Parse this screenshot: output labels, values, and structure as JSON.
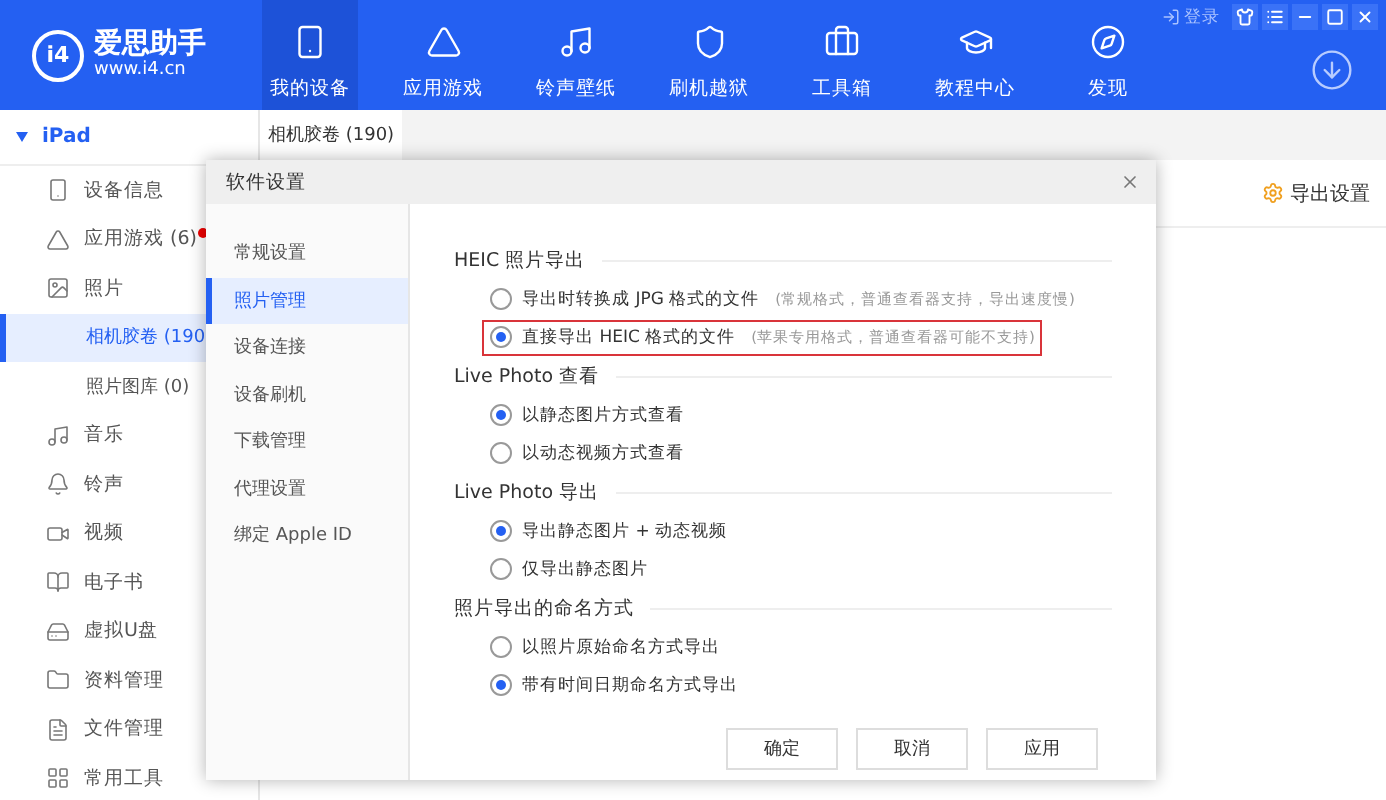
{
  "header": {
    "logo_mark": "i4",
    "logo_name": "爱思助手",
    "logo_url": "www.i4.cn",
    "login": "登录",
    "nav": [
      {
        "label": "我的设备",
        "selected": true
      },
      {
        "label": "应用游戏",
        "selected": false
      },
      {
        "label": "铃声壁纸",
        "selected": false
      },
      {
        "label": "刷机越狱",
        "selected": false
      },
      {
        "label": "工具箱",
        "selected": false
      },
      {
        "label": "教程中心",
        "selected": false
      },
      {
        "label": "发现",
        "selected": false
      }
    ]
  },
  "sidebar": {
    "device": "iPad",
    "expanded": true,
    "items": [
      {
        "label": "设备信息",
        "selected": false
      },
      {
        "label": "应用游戏 (6)",
        "selected": false,
        "badge": true
      },
      {
        "label": "照片",
        "selected": false,
        "children": [
          {
            "label": "相机胶卷 (190",
            "selected": true
          },
          {
            "label": "照片图库 (0)",
            "selected": false
          }
        ]
      },
      {
        "label": "音乐",
        "selected": false
      },
      {
        "label": "铃声",
        "selected": false
      },
      {
        "label": "视频",
        "selected": false
      },
      {
        "label": "电子书",
        "selected": false
      },
      {
        "label": "虚拟U盘",
        "selected": false
      },
      {
        "label": "资料管理",
        "selected": false
      },
      {
        "label": "文件管理",
        "selected": false
      },
      {
        "label": "常用工具",
        "selected": false
      }
    ]
  },
  "tabs": [
    {
      "label": "相机胶卷 (190)",
      "selected": true
    }
  ],
  "toolbar": {
    "export_settings": "导出设置"
  },
  "dialog": {
    "title": "软件设置",
    "nav": [
      {
        "label": "常规设置",
        "selected": false
      },
      {
        "label": "照片管理",
        "selected": true
      },
      {
        "label": "设备连接",
        "selected": false
      },
      {
        "label": "设备刷机",
        "selected": false
      },
      {
        "label": "下载管理",
        "selected": false
      },
      {
        "label": "代理设置",
        "selected": false
      },
      {
        "label": "绑定 Apple ID",
        "selected": false
      }
    ],
    "sections": [
      {
        "title": "HEIC 照片导出",
        "options": [
          {
            "label": "导出时转换成 JPG 格式的文件",
            "note": "(常规格式，普通查看器支持，导出速度慢)",
            "selected": false,
            "highlighted": false
          },
          {
            "label": "直接导出 HEIC 格式的文件",
            "note": "(苹果专用格式，普通查看器可能不支持)",
            "selected": true,
            "highlighted": true
          }
        ]
      },
      {
        "title": "Live Photo 查看",
        "options": [
          {
            "label": "以静态图片方式查看",
            "selected": true,
            "highlighted": false
          },
          {
            "label": "以动态视频方式查看",
            "selected": false,
            "highlighted": false
          }
        ]
      },
      {
        "title": "Live Photo 导出",
        "options": [
          {
            "label": "导出静态图片 + 动态视频",
            "selected": true,
            "highlighted": false
          },
          {
            "label": "仅导出静态图片",
            "selected": false,
            "highlighted": false
          }
        ]
      },
      {
        "title": "照片导出的命名方式",
        "options": [
          {
            "label": "以照片原始命名方式导出",
            "selected": false,
            "highlighted": false
          },
          {
            "label": "带有时间日期命名方式导出",
            "selected": true,
            "highlighted": false
          }
        ]
      }
    ],
    "buttons": [
      "确定",
      "取消",
      "应用"
    ]
  }
}
